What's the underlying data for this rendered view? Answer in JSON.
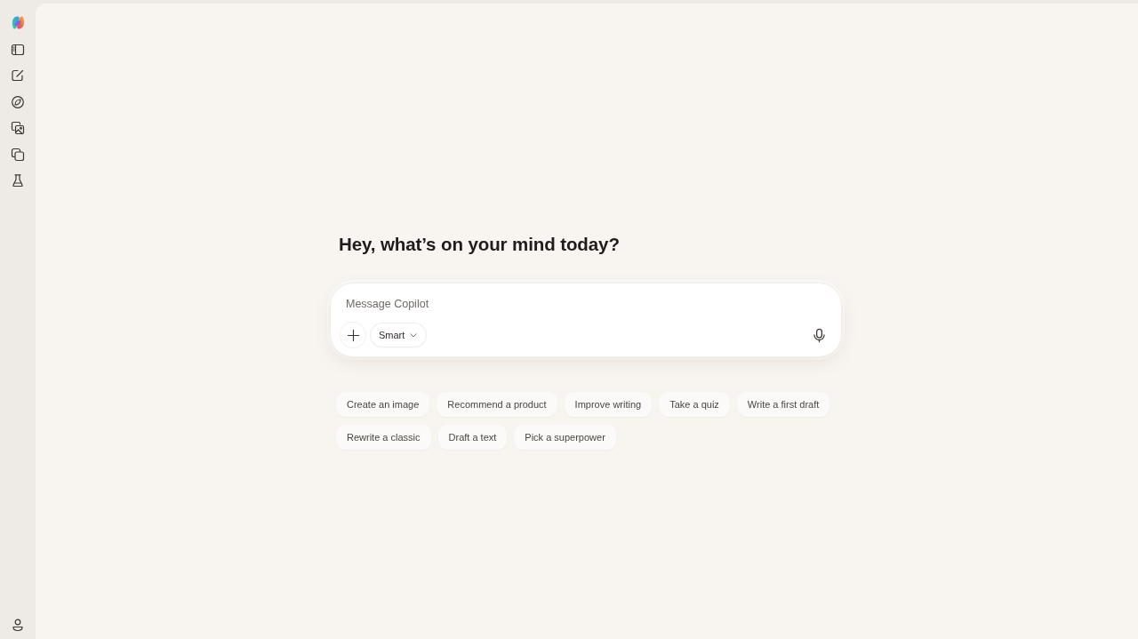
{
  "heading": "Hey, what’s on your mind today?",
  "composer": {
    "placeholder": "Message Copilot",
    "mode": "Smart"
  },
  "suggestions": [
    "Create an image",
    "Recommend a product",
    "Improve writing",
    "Take a quiz",
    "Write a first draft",
    "Rewrite a classic",
    "Draft a text",
    "Pick a superpower"
  ]
}
